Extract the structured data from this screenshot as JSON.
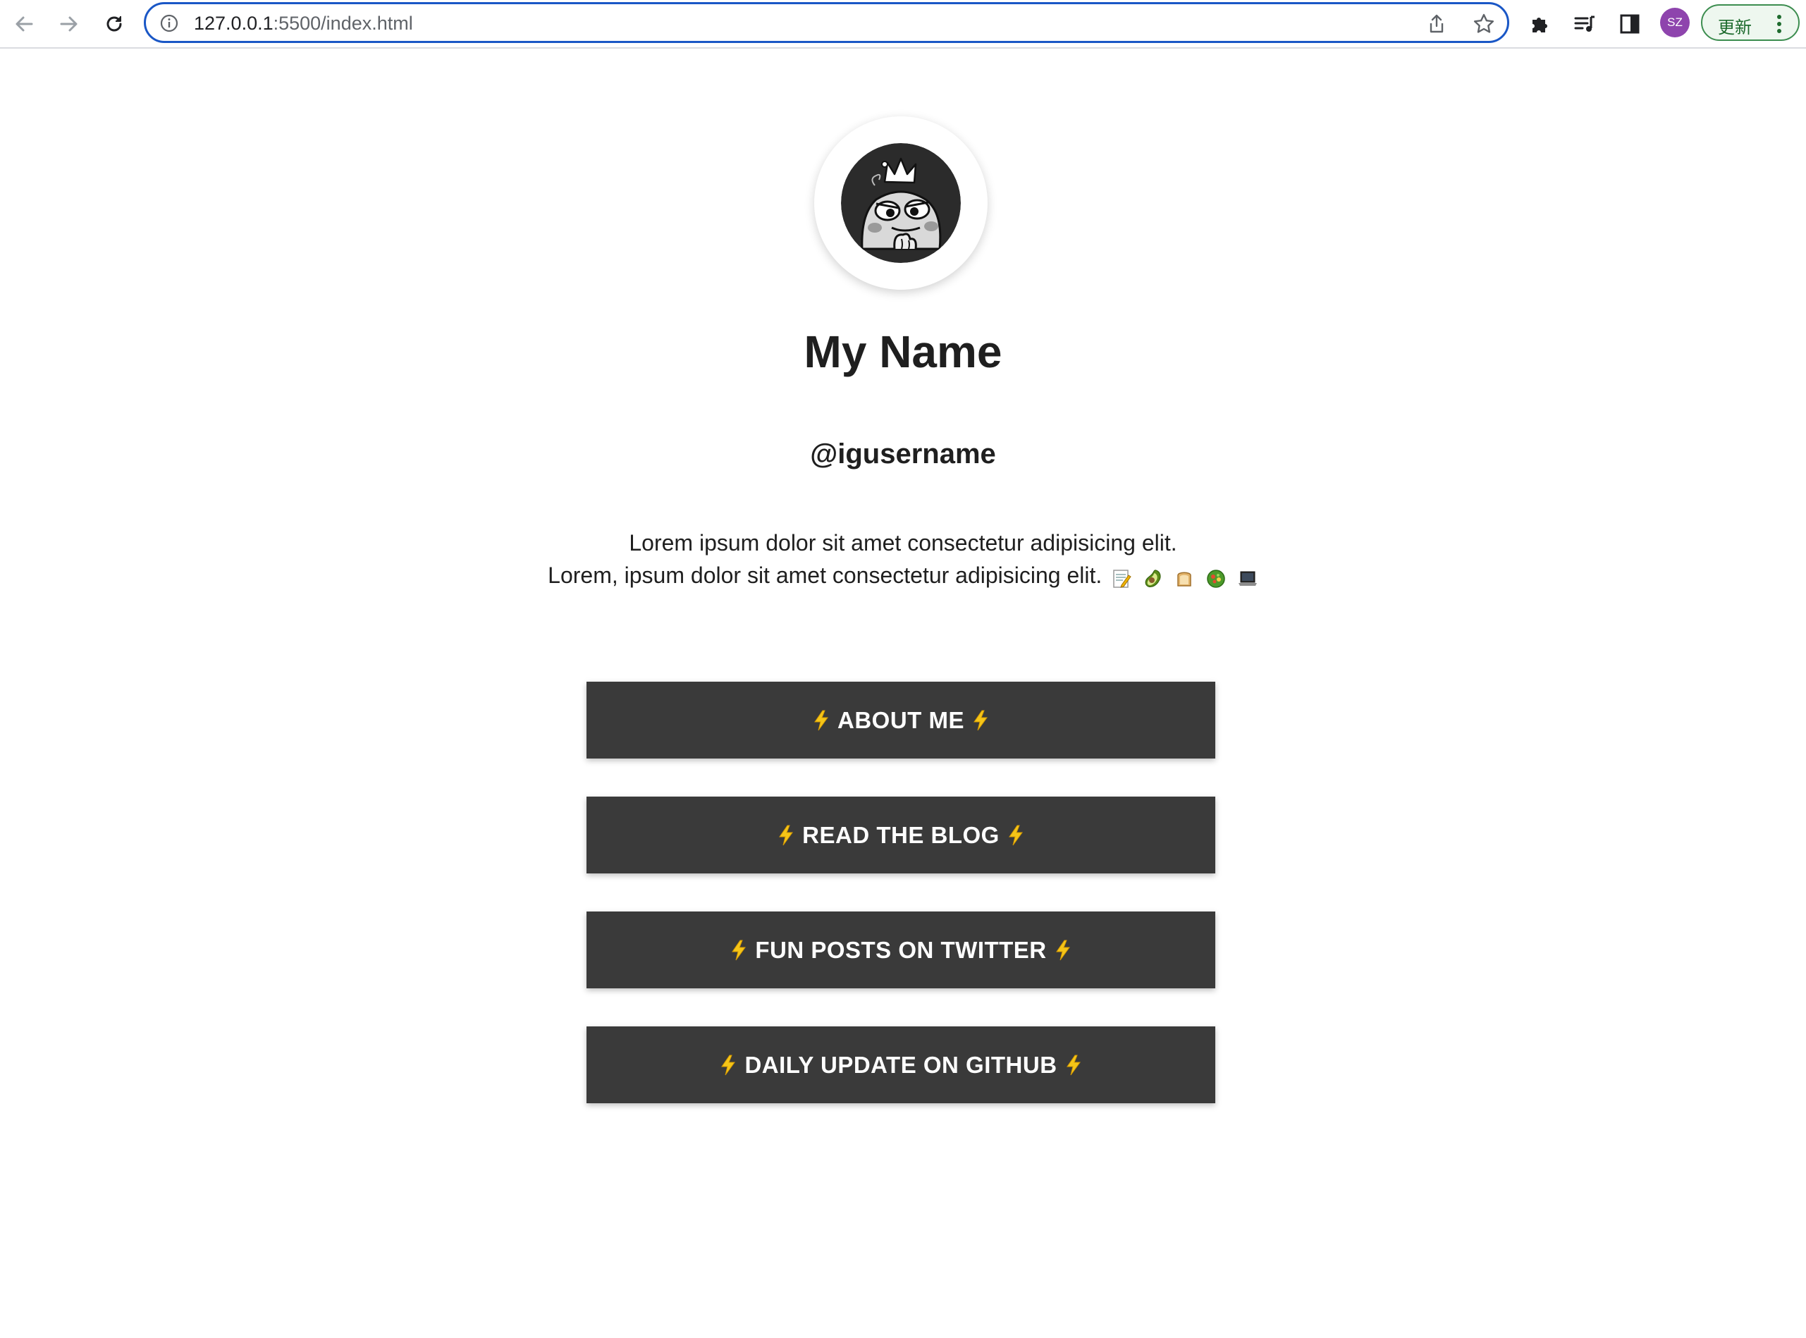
{
  "browser": {
    "url_host": "127.0.0.1",
    "url_rest": ":5500/index.html",
    "profile_initials": "SZ",
    "update_label": "更新",
    "colors": {
      "omnibox_border": "#1a57c6",
      "profile": "#8e44ad",
      "update_green": "#3c8d4f"
    }
  },
  "profile": {
    "name": "My Name",
    "username": "@igusername",
    "bio_line1": "Lorem ipsum dolor sit amet consectetur adipisicing elit.",
    "bio_line2": "Lorem, ipsum dolor sit amet consectetur adipisicing elit.",
    "bio_emojis": [
      "memo",
      "avocado",
      "bread",
      "salad",
      "laptop"
    ]
  },
  "links": [
    {
      "label": "ABOUT ME"
    },
    {
      "label": "READ THE BLOG"
    },
    {
      "label": "FUN POSTS ON TWITTER"
    },
    {
      "label": "DAILY UPDATE ON GITHUB"
    }
  ],
  "colors": {
    "button_bg": "#3a3a3a",
    "button_text": "#ffffff",
    "bolt": "#f5c518"
  }
}
